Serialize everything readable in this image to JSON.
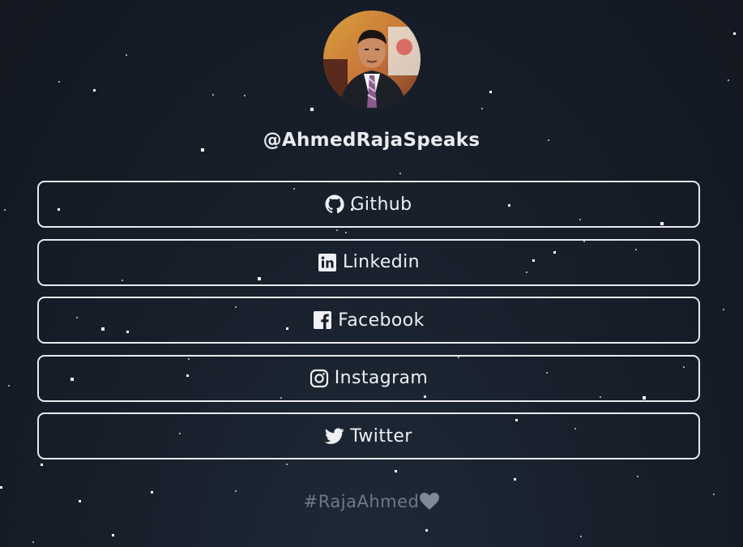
{
  "profile": {
    "handle": "@AhmedRajaSpeaks",
    "avatar_icon": "profile-photo"
  },
  "links": [
    {
      "label": "Github",
      "icon": "github-icon"
    },
    {
      "label": "Linkedin",
      "icon": "linkedin-icon"
    },
    {
      "label": "Facebook",
      "icon": "facebook-icon"
    },
    {
      "label": "Instagram",
      "icon": "instagram-icon"
    },
    {
      "label": "Twitter",
      "icon": "twitter-icon"
    }
  ],
  "footer": {
    "tag": "#RajaAhmed",
    "icon": "heart-icon"
  },
  "colors": {
    "background": "#161d28",
    "border": "#e8eaed",
    "footer_text": "#6f7886"
  }
}
